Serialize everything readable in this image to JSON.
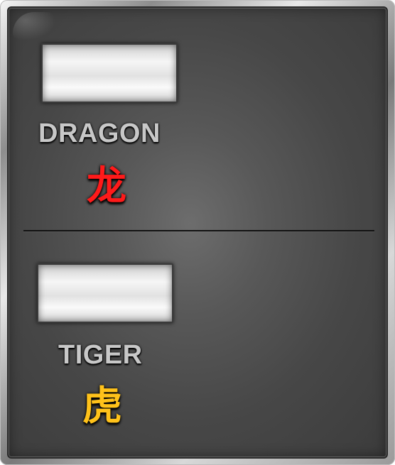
{
  "dragon": {
    "label": "DRAGON",
    "glyph": "龙",
    "glyph_color": "#ff1a1a"
  },
  "tiger": {
    "label": "TIGER",
    "glyph": "虎",
    "glyph_color": "#ffc21a"
  },
  "colors": {
    "panel": "#4a4a4a",
    "frame": "#bfbfbf",
    "label_text": "#c8c8c8"
  }
}
